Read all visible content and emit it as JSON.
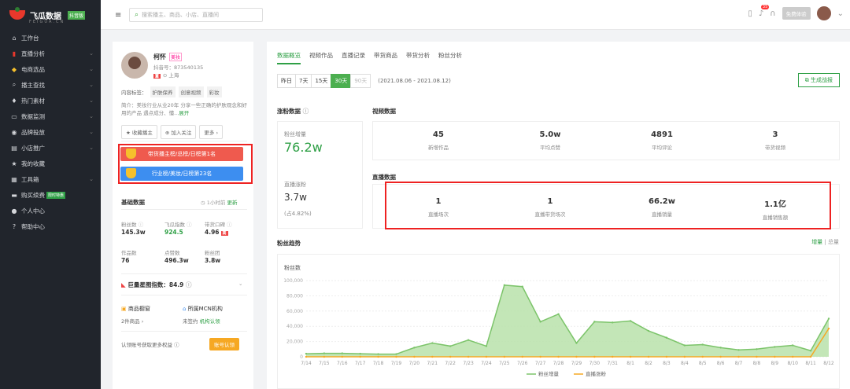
{
  "app": {
    "name": "飞瓜数据",
    "badge": "抖音版",
    "sub": "FEIGUA.CN"
  },
  "sidebar": {
    "items": [
      {
        "label": "工作台",
        "icon": "home-icon",
        "chev": false
      },
      {
        "label": "直播分析",
        "icon": "bar-icon",
        "chev": true
      },
      {
        "label": "电商选品",
        "icon": "bag-icon",
        "chev": true
      },
      {
        "label": "播主查找",
        "icon": "search-icon",
        "chev": true
      },
      {
        "label": "热门素材",
        "icon": "thumb-icon",
        "chev": true
      },
      {
        "label": "数据监测",
        "icon": "monitor-icon",
        "chev": true
      },
      {
        "label": "品牌投放",
        "icon": "brand-icon",
        "chev": true
      },
      {
        "label": "小店推广",
        "icon": "shop-icon",
        "chev": true
      },
      {
        "label": "我的收藏",
        "icon": "star-icon",
        "chev": false
      },
      {
        "label": "工具箱",
        "icon": "toolbox-icon",
        "chev": true
      },
      {
        "label": "购买续费",
        "icon": "card-icon",
        "chev": false,
        "badge": "限时特惠"
      },
      {
        "label": "个人中心",
        "icon": "user-icon",
        "chev": false
      },
      {
        "label": "帮助中心",
        "icon": "help-icon",
        "chev": false
      }
    ]
  },
  "topbar": {
    "search_placeholder": "搜索播主、商品、小店、直播间",
    "notif_count": "35",
    "login": "免费体验"
  },
  "profile": {
    "name": "柯怀",
    "tag": "美妆",
    "id": "抖音号：873540135",
    "location": "上海",
    "content_label": "内容标签：",
    "tags": [
      "护肤保养",
      "创意视频",
      "彩妆"
    ],
    "intro": "简介：美妆行业从业20年 分享一些正确的护肤观念和好用的产品 遇点成分、懂...",
    "intro_more": "展开",
    "btn_fav": "收藏播主",
    "btn_follow": "加入关注",
    "btn_more": "更多"
  },
  "ranks": {
    "r1": "带货播主榜/总榜/日榜第1名",
    "r2": "行业榜/美妆/日榜第23名"
  },
  "basic": {
    "title": "基础数据",
    "updated": "1小时前",
    "update_link": "更新",
    "stats": [
      {
        "label": "粉丝数",
        "value": "145.3w"
      },
      {
        "label": "飞瓜指数",
        "value": "924.5"
      },
      {
        "label": "带货口碑",
        "value": "4.96",
        "badge": "高"
      },
      {
        "label": "作品数",
        "value": "76"
      },
      {
        "label": "点赞数",
        "value": "496.3w"
      },
      {
        "label": "粉丝团",
        "value": "3.8w"
      }
    ]
  },
  "xingtu": {
    "label": "巨量星图指数：84.9"
  },
  "extra": {
    "showcase": "商品橱窗",
    "showcase_val": "2件商品",
    "mcn": "所属MCN机构",
    "mcn_val": "未签约",
    "mcn_link": "机构认领",
    "auth_text": "认领账号获取更多权益",
    "auth_btn": "账号认领"
  },
  "tabs": [
    "数据概览",
    "视频作品",
    "直播记录",
    "带货商品",
    "带货分析",
    "粉丝分析"
  ],
  "range": {
    "opts": [
      "昨日",
      "7天",
      "15天",
      "30天",
      "90天"
    ],
    "dates": "(2021.08.06 - 2021.08.12)",
    "gen": "生成战报"
  },
  "fans": {
    "title": "涨粉数据",
    "inc_label": "粉丝增量",
    "inc_value": "76.2w",
    "live_label": "直播涨粉",
    "live_value": "3.7w",
    "live_pct": "(占4.82%)"
  },
  "video": {
    "title": "视频数据",
    "items": [
      {
        "v": "45",
        "l": "新增作品"
      },
      {
        "v": "5.0w",
        "l": "平均点赞"
      },
      {
        "v": "4891",
        "l": "平均评论"
      },
      {
        "v": "3",
        "l": "带货视频"
      }
    ]
  },
  "live": {
    "title": "直播数据",
    "items": [
      {
        "v": "1",
        "l": "直播场次"
      },
      {
        "v": "1",
        "l": "直播带货场次"
      },
      {
        "v": "66.2w",
        "l": "直播销量"
      },
      {
        "v": "1.1亿",
        "l": "直播销售额"
      }
    ]
  },
  "trend": {
    "title": "粉丝趋势",
    "switch_a": "增量",
    "switch_b": "总量"
  },
  "chart_data": {
    "type": "area",
    "ylabel": "粉丝数",
    "ylim": [
      0,
      100000
    ],
    "yticks": [
      "100,000",
      "80,000",
      "60,000",
      "40,000",
      "20,000",
      "0"
    ],
    "categories": [
      "7/14",
      "7/15",
      "7/16",
      "7/17",
      "7/18",
      "7/19",
      "7/20",
      "7/21",
      "7/22",
      "7/23",
      "7/24",
      "7/25",
      "7/26",
      "7/27",
      "7/28",
      "7/29",
      "7/30",
      "7/31",
      "8/1",
      "8/2",
      "8/3",
      "8/4",
      "8/5",
      "8/6",
      "8/7",
      "8/8",
      "8/9",
      "8/10",
      "8/11",
      "8/12"
    ],
    "series": [
      {
        "name": "粉丝增量",
        "color": "#7cc46a",
        "values": [
          4000,
          4500,
          4500,
          4000,
          3500,
          3500,
          12000,
          18000,
          14000,
          22000,
          14000,
          94000,
          92000,
          46000,
          56000,
          18000,
          46000,
          45000,
          47000,
          34000,
          25000,
          15000,
          16000,
          12000,
          9000,
          10000,
          13000,
          15000,
          8000,
          50000
        ]
      },
      {
        "name": "直播涨粉",
        "color": "#f6a823",
        "values": [
          0,
          0,
          0,
          0,
          0,
          0,
          0,
          0,
          0,
          0,
          0,
          0,
          0,
          0,
          0,
          0,
          0,
          0,
          0,
          0,
          0,
          0,
          0,
          0,
          0,
          0,
          0,
          0,
          0,
          37000
        ]
      }
    ]
  }
}
